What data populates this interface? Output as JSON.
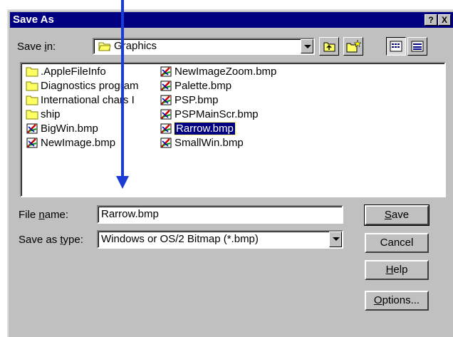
{
  "dialog": {
    "title": "Save As",
    "help_glyph": "?",
    "close_glyph": "X"
  },
  "save_in": {
    "label_prefix": "Save ",
    "label_accel": "i",
    "label_suffix": "n:",
    "value": "Graphics"
  },
  "files": [
    {
      "name": ".AppleFileInfo",
      "type": "folder",
      "col": 0,
      "row": 0
    },
    {
      "name": "Diagnostics program",
      "type": "folder",
      "col": 0,
      "row": 1
    },
    {
      "name": "International chars I",
      "type": "folder",
      "col": 0,
      "row": 2
    },
    {
      "name": "ship",
      "type": "folder",
      "col": 0,
      "row": 3
    },
    {
      "name": "BigWin.bmp",
      "type": "bmp",
      "col": 0,
      "row": 4
    },
    {
      "name": "NewImage.bmp",
      "type": "bmp",
      "col": 0,
      "row": 5
    },
    {
      "name": "NewImageZoom.bmp",
      "type": "bmp",
      "col": 1,
      "row": 0
    },
    {
      "name": "Palette.bmp",
      "type": "bmp",
      "col": 1,
      "row": 1
    },
    {
      "name": "PSP.bmp",
      "type": "bmp",
      "col": 1,
      "row": 2
    },
    {
      "name": "PSPMainScr.bmp",
      "type": "bmp",
      "col": 1,
      "row": 3
    },
    {
      "name": "Rarrow.bmp",
      "type": "bmp",
      "col": 1,
      "row": 4,
      "selected": true
    },
    {
      "name": "SmallWin.bmp",
      "type": "bmp",
      "col": 1,
      "row": 5
    }
  ],
  "file_name": {
    "label_prefix": "File ",
    "label_accel": "n",
    "label_suffix": "ame:",
    "value": "Rarrow.bmp"
  },
  "save_as_type": {
    "label_prefix": "Save as ",
    "label_accel": "t",
    "label_suffix": "ype:",
    "value": "Windows or OS/2 Bitmap (*.bmp)"
  },
  "buttons": {
    "save": {
      "accel": "S",
      "rest": "ave"
    },
    "cancel": {
      "label": "Cancel"
    },
    "help": {
      "accel": "H",
      "rest": "elp"
    },
    "options": {
      "accel": "O",
      "rest": "ptions..."
    }
  },
  "colors": {
    "titlebar": "#000080",
    "dialog_face": "#c0c0c0",
    "annotation_arrow": "#1a3bd6",
    "selection": "#000080"
  }
}
